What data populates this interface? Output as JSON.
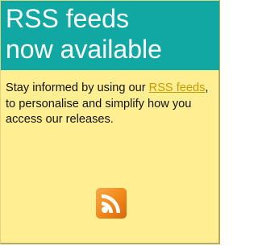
{
  "promo": {
    "title_line1": "RSS feeds",
    "title_line2": "now available",
    "body_before_link": "Stay informed by using our ",
    "link_text": "RSS feeds",
    "body_after_link": ", to personalise and simplify how you access our releases.",
    "icon": "rss-feed-icon"
  },
  "colors": {
    "title_band": "#11a7a2",
    "panel_background": "#ffef92",
    "link": "#c89b00",
    "icon_orange": "#f28a1c"
  }
}
